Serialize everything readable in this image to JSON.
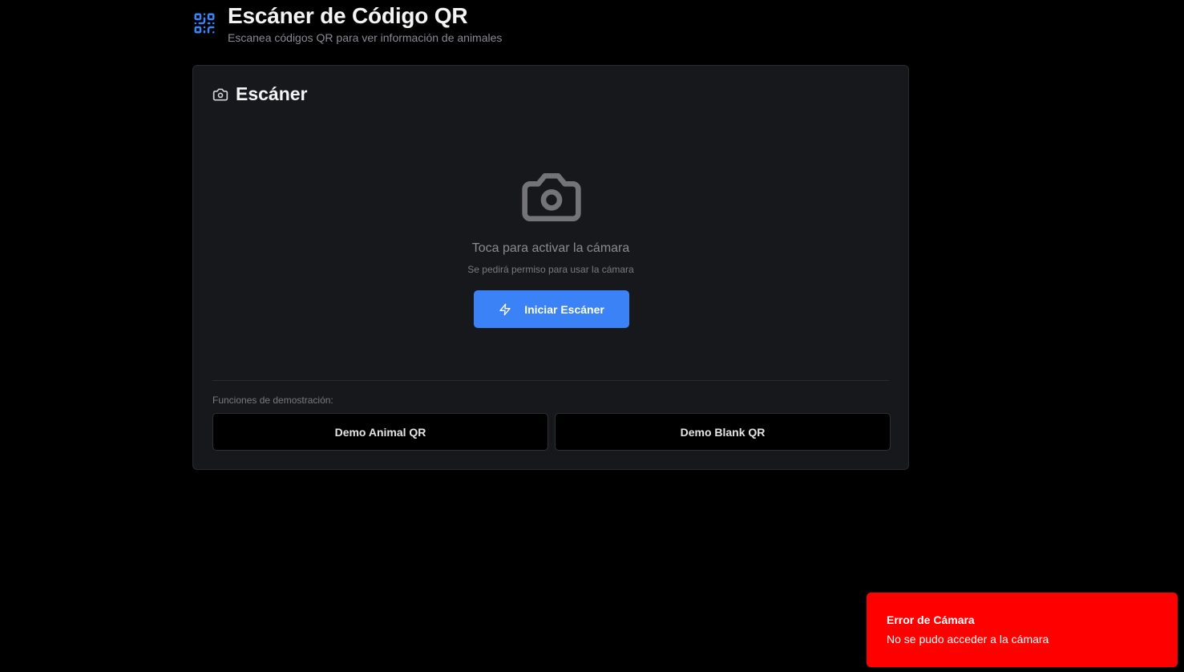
{
  "header": {
    "title": "Escáner de Código QR",
    "subtitle": "Escanea códigos QR para ver información de animales",
    "icon": "qr-code-icon",
    "accent_color": "#3b82f6"
  },
  "scanner": {
    "title": "Escáner",
    "icon": "camera-icon",
    "prompt": "Toca para activar la cámara",
    "hint": "Se pedirá permiso para usar la cámara",
    "start_button": "Iniciar Escáner",
    "start_button_icon": "bolt-icon",
    "start_button_color": "#3b82f6"
  },
  "demo": {
    "label": "Funciones de demostración:",
    "animal_button": "Demo Animal QR",
    "blank_button": "Demo Blank QR"
  },
  "toast": {
    "title": "Error de Cámara",
    "message": "No se pudo acceder a la cámara",
    "color": "#ff0000"
  }
}
